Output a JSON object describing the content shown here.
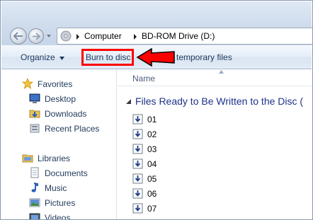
{
  "address": {
    "crumbs": [
      "Computer",
      "BD-ROM Drive (D:)"
    ]
  },
  "toolbar": {
    "organize_label": "Organize",
    "burn_label": "Burn to disc",
    "temp_files_label": "temporary files"
  },
  "navpane": {
    "favorites_header": "Favorites",
    "favorites": [
      "Desktop",
      "Downloads",
      "Recent Places"
    ],
    "libraries_header": "Libraries",
    "libraries": [
      "Documents",
      "Music",
      "Pictures",
      "Videos"
    ]
  },
  "content": {
    "column_name": "Name",
    "group_title": "Files Ready to Be Written to the Disc (",
    "files": [
      "01",
      "02",
      "03",
      "04",
      "05",
      "06",
      "07"
    ]
  },
  "colors": {
    "highlight": "#ff0000",
    "link_text": "#1e395b",
    "group_text": "#1e3287"
  }
}
